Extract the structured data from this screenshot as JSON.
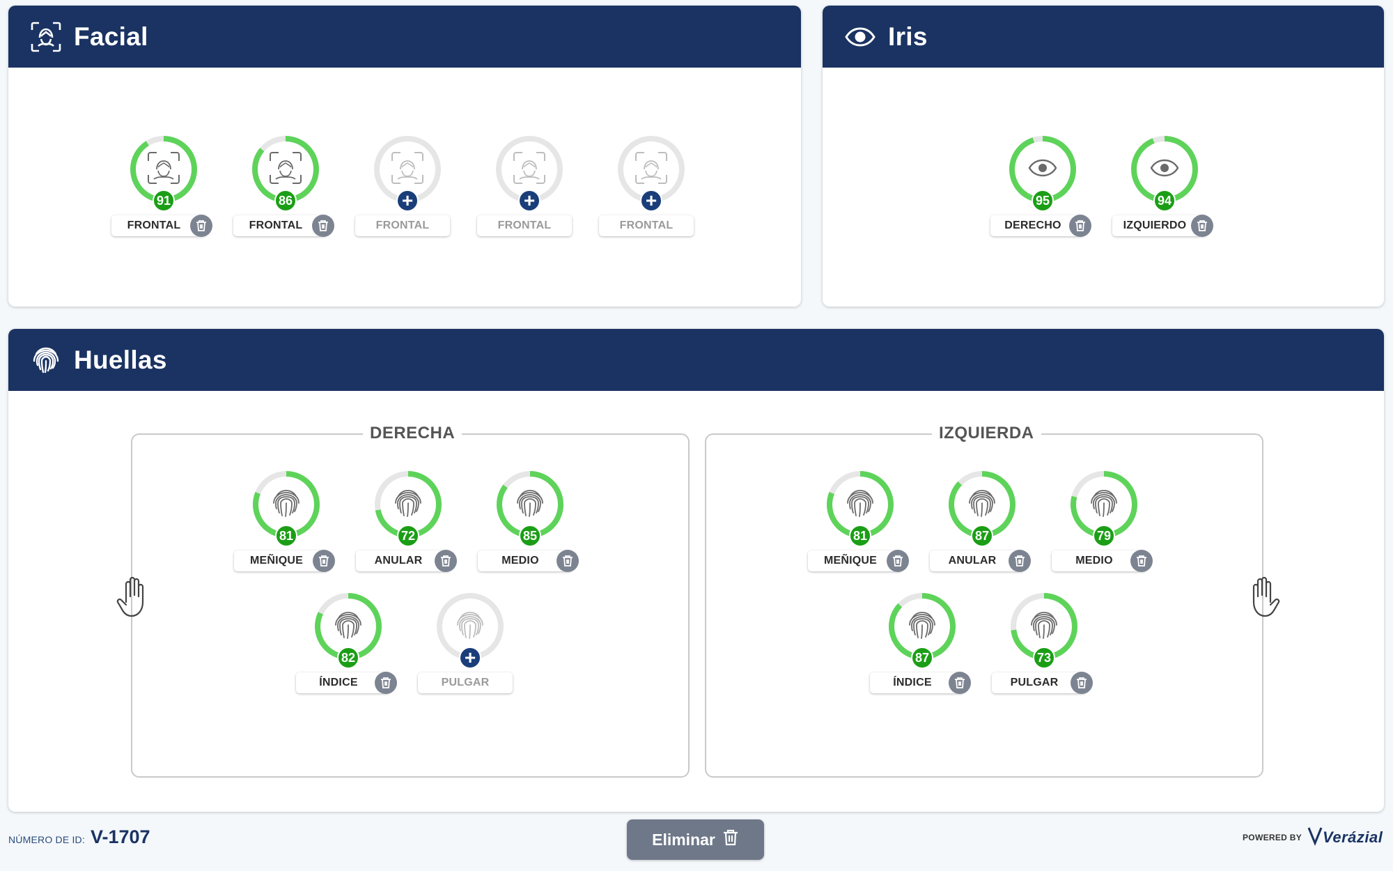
{
  "facial": {
    "title": "Facial",
    "icon": "face-scan-icon",
    "samples": [
      {
        "label": "FRONTAL",
        "score": "91",
        "score_value": 91,
        "captured": true
      },
      {
        "label": "FRONTAL",
        "score": "86",
        "score_value": 86,
        "captured": true
      },
      {
        "label": "FRONTAL",
        "score": "",
        "captured": false
      },
      {
        "label": "FRONTAL",
        "score": "",
        "captured": false
      },
      {
        "label": "FRONTAL",
        "score": "",
        "captured": false
      }
    ]
  },
  "iris": {
    "title": "Iris",
    "icon": "eye-icon",
    "samples": [
      {
        "label": "DERECHO",
        "score": "95",
        "score_value": 95,
        "captured": true
      },
      {
        "label": "IZQUIERDO",
        "score": "94",
        "score_value": 94,
        "captured": true
      }
    ]
  },
  "huellas": {
    "title": "Huellas",
    "icon": "fingerprint-icon",
    "right": {
      "legend": "DERECHA",
      "fingers": [
        {
          "label": "MEÑIQUE",
          "score": "81",
          "score_value": 81,
          "captured": true
        },
        {
          "label": "ANULAR",
          "score": "72",
          "score_value": 72,
          "captured": true
        },
        {
          "label": "MEDIO",
          "score": "85",
          "score_value": 85,
          "captured": true
        },
        {
          "label": "ÍNDICE",
          "score": "82",
          "score_value": 82,
          "captured": true
        },
        {
          "label": "PULGAR",
          "score": "",
          "captured": false
        }
      ]
    },
    "left": {
      "legend": "IZQUIERDA",
      "fingers": [
        {
          "label": "MEÑIQUE",
          "score": "81",
          "score_value": 81,
          "captured": true
        },
        {
          "label": "ANULAR",
          "score": "87",
          "score_value": 87,
          "captured": true
        },
        {
          "label": "MEDIO",
          "score": "79",
          "score_value": 79,
          "captured": true
        },
        {
          "label": "ÍNDICE",
          "score": "87",
          "score_value": 87,
          "captured": true
        },
        {
          "label": "PULGAR",
          "score": "73",
          "score_value": 73,
          "captured": true
        }
      ]
    }
  },
  "footer": {
    "id_label": "NÚMERO DE ID:",
    "id_value": "V-1707",
    "delete_label": "Eliminar",
    "powered_by": "POWERED BY",
    "brand": "Verázial"
  },
  "colors": {
    "header": "#1a3362",
    "ring_green": "#5ed35a",
    "badge_green": "#1b9e16",
    "add_blue": "#1a3e7a",
    "trash_gray": "#7d8491"
  }
}
